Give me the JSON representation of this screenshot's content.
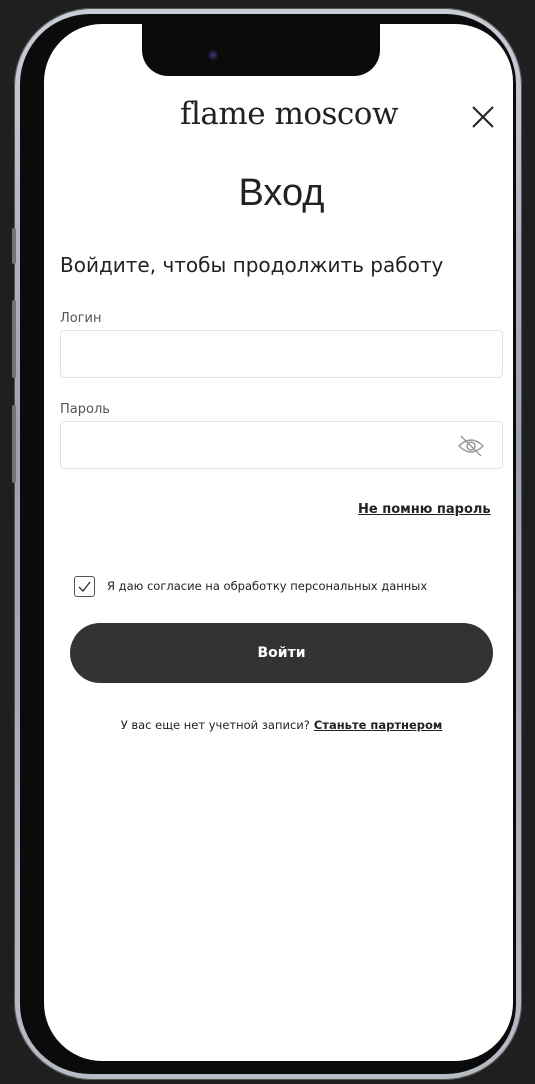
{
  "app": {
    "logo_text": "flame moscow",
    "close_icon": "close-icon"
  },
  "login": {
    "title": "Вход",
    "subtitle": "Войдите, чтобы продолжить работу",
    "login_label": "Логин",
    "login_value": "",
    "password_label": "Пароль",
    "password_value": "",
    "password_toggle_icon": "eye-off-icon",
    "forgot_link": "Не помню пароль",
    "consent_text": "Я даю согласие на обработку персональных данных",
    "consent_checked": true,
    "submit_label": "Войти",
    "signup_prompt": "У вас еще нет учетной записи?",
    "signup_link": "Станьте партнером"
  },
  "colors": {
    "button_bg": "#333333",
    "background": "#1f1f20",
    "screen": "#ffffff"
  }
}
